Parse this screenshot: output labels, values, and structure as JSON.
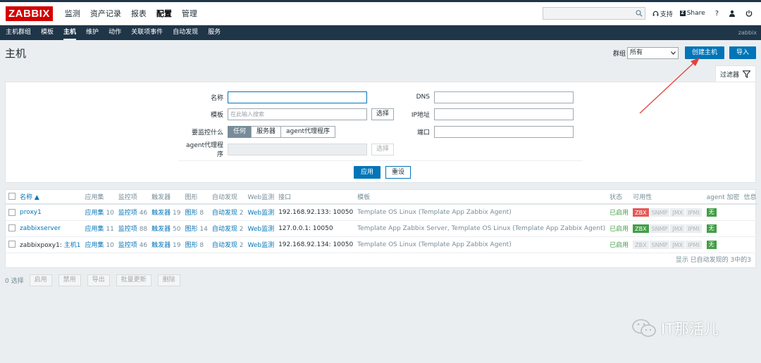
{
  "header": {
    "logo": "ZABBIX",
    "menu": [
      "监测",
      "资产记录",
      "报表",
      "配置",
      "管理"
    ],
    "active_menu": "配置",
    "support": "支持",
    "share": "Share",
    "help": "?"
  },
  "submenu": {
    "items": [
      "主机群组",
      "模板",
      "主机",
      "维护",
      "动作",
      "关联项事件",
      "自动发现",
      "服务"
    ],
    "active": "主机",
    "user": "zabbix"
  },
  "page": {
    "title": "主机",
    "group_label": "群组",
    "group_value": "所有",
    "create_button": "创建主机",
    "import_button": "导入"
  },
  "filter": {
    "tab_label": "过滤器",
    "name_label": "名称",
    "template_label": "模板",
    "template_placeholder": "在此输入搜索",
    "select_button": "选择",
    "monitored_by_label": "要监控什么",
    "monitored_options": [
      "任何",
      "服务器",
      "agent代理程序"
    ],
    "proxy_label": "agent代理程序",
    "dns_label": "DNS",
    "ip_label": "IP地址",
    "port_label": "端口",
    "apply_button": "应用",
    "reset_button": "重设"
  },
  "table": {
    "headers": {
      "name": "名称 ▲",
      "apps": "应用集",
      "items": "监控项",
      "triggers": "触发器",
      "graphs": "图形",
      "discovery": "自动发现",
      "web": "Web监测",
      "interface": "接口",
      "templates": "模板",
      "status": "状态",
      "availability": "可用性",
      "encryption": "agent 加密",
      "info": "信息"
    },
    "rows": [
      {
        "name": "proxy1",
        "proxy_prefix": "",
        "apps_label": "应用集",
        "apps": "10",
        "items_label": "监控项",
        "items": "46",
        "triggers_label": "触发器",
        "triggers": "19",
        "graphs_label": "图形",
        "graphs": "8",
        "discovery_label": "自动发现",
        "discovery": "2",
        "web": "Web监测",
        "interface": "192.168.92.133: 10050",
        "tpl_main": "Template OS Linux",
        "tpl_paren": "Template App Zabbix Agent",
        "status": "已启用",
        "zbx_state": "off",
        "enc": "无"
      },
      {
        "name": "zabbixserver",
        "proxy_prefix": "",
        "apps_label": "应用集",
        "apps": "11",
        "items_label": "监控项",
        "items": "88",
        "triggers_label": "触发器",
        "triggers": "50",
        "graphs_label": "图形",
        "graphs": "14",
        "discovery_label": "自动发现",
        "discovery": "2",
        "web": "Web监测",
        "interface": "127.0.0.1: 10050",
        "tpl_main": "Template App Zabbix Server, Template OS Linux",
        "tpl_paren": "Template App Zabbix Agent",
        "status": "已启用",
        "zbx_state": "on",
        "enc": "无"
      },
      {
        "name": "主机1",
        "proxy_prefix": "zabbixpoxy1: ",
        "apps_label": "应用集",
        "apps": "10",
        "items_label": "监控项",
        "items": "46",
        "triggers_label": "触发器",
        "triggers": "19",
        "graphs_label": "图形",
        "graphs": "8",
        "discovery_label": "自动发现",
        "discovery": "2",
        "web": "Web监测",
        "interface": "192.168.92.134: 10050",
        "tpl_main": "Template OS Linux",
        "tpl_paren": "Template App Zabbix Agent",
        "status": "已启用",
        "zbx_state": "none",
        "enc": "无"
      }
    ],
    "avail_labels": [
      "ZBX",
      "SNMP",
      "JMX",
      "IPMI"
    ],
    "footer": "显示 已自动发现的 3中的3"
  },
  "actions": {
    "selected": "0 选择",
    "buttons": [
      "启用",
      "禁用",
      "导出",
      "批量更新",
      "删除"
    ]
  },
  "watermark": "IT那活儿",
  "colors": {
    "brand": "#d40000",
    "nav": "#1f3548",
    "primary": "#0275b8",
    "enabled": "#429e47",
    "error": "#e45959",
    "annotation_arrow": "#e8403a"
  }
}
